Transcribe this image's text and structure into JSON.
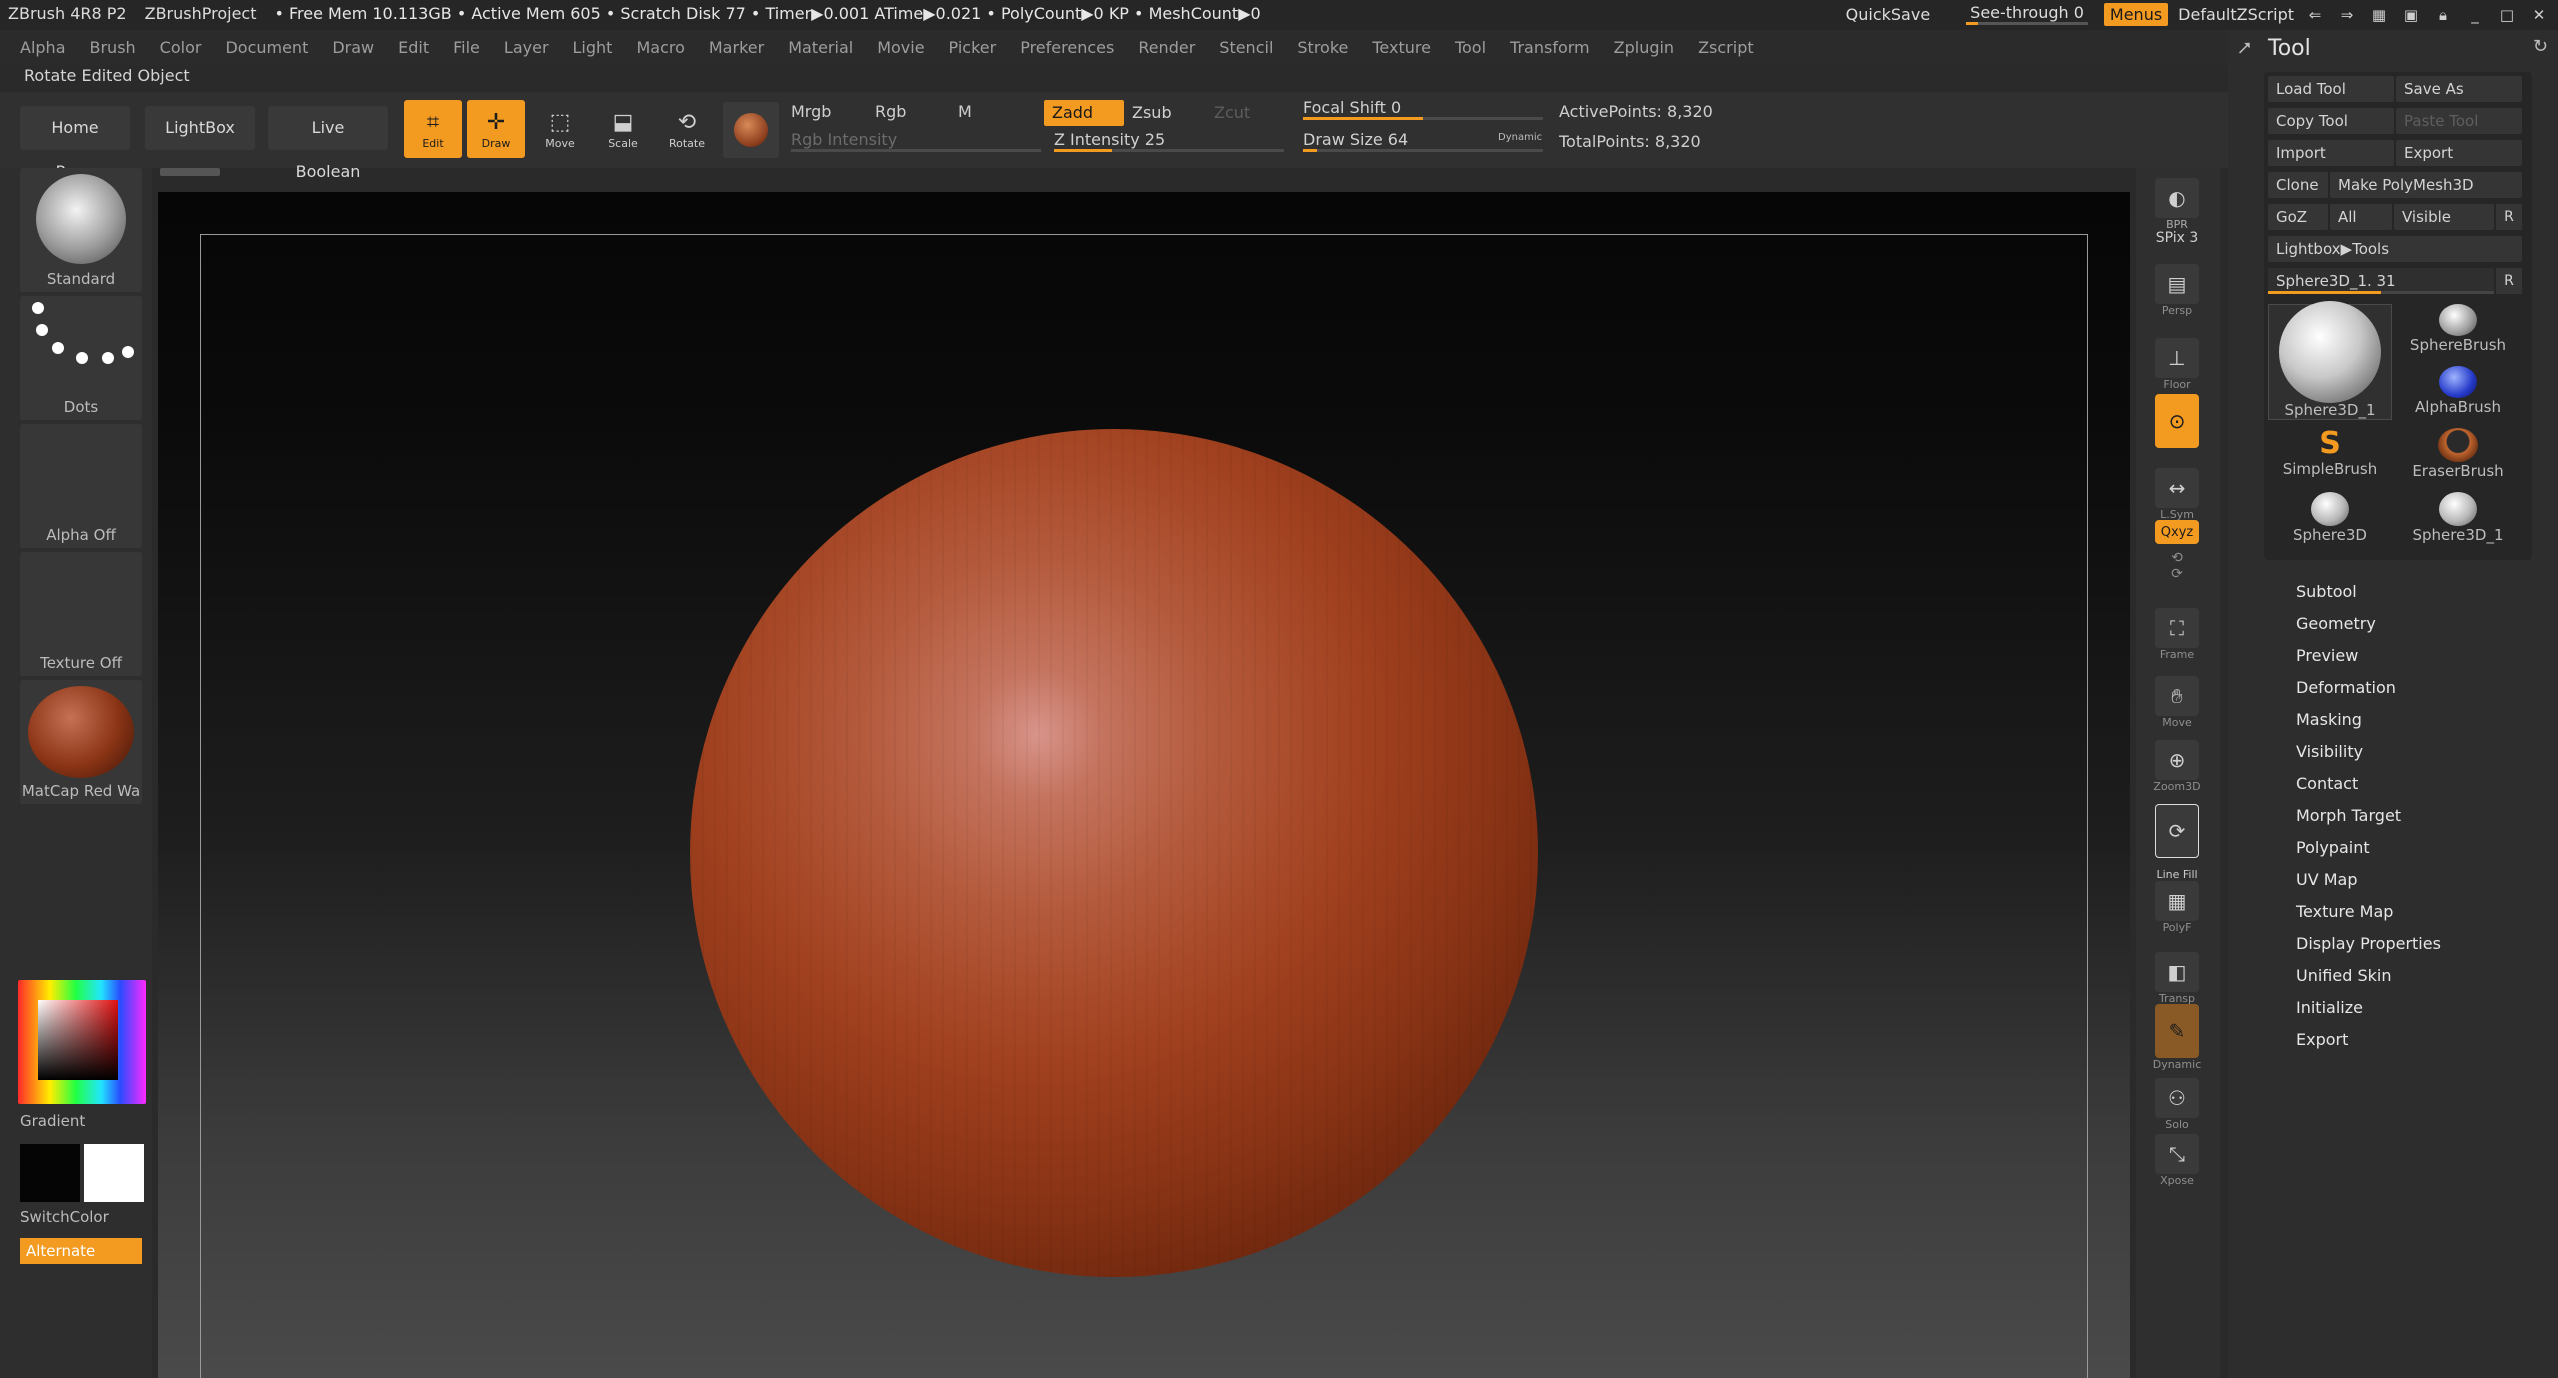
{
  "titlebar": {
    "app": "ZBrush 4R8 P2",
    "project": "ZBrushProject",
    "stats": "• Free Mem 10.113GB • Active Mem 605 • Scratch Disk 77 • Timer▶0.001 ATime▶0.021 • PolyCount▶0 KP • MeshCount▶0",
    "quicksave": "QuickSave",
    "seethrough": "See-through  0",
    "menus": "Menus",
    "script": "DefaultZScript"
  },
  "menubar": {
    "items": [
      "Alpha",
      "Brush",
      "Color",
      "Document",
      "Draw",
      "Edit",
      "File",
      "Layer",
      "Light",
      "Macro",
      "Marker",
      "Material",
      "Movie",
      "Picker",
      "Preferences",
      "Render",
      "Stencil",
      "Stroke",
      "Texture",
      "Tool",
      "Transform",
      "Zplugin",
      "Zscript"
    ]
  },
  "subtitle": "Rotate Edited Object",
  "shelf": {
    "home": "Home Page",
    "lightbox": "LightBox",
    "liveboolean": "Live Boolean",
    "edit": "Edit",
    "draw": "Draw",
    "move": "Move",
    "scale": "Scale",
    "rotate": "Rotate",
    "mrgb": "Mrgb",
    "rgb": "Rgb",
    "m": "M",
    "rgb_intensity": "Rgb Intensity",
    "zadd": "Zadd",
    "zsub": "Zsub",
    "zcut": "Zcut",
    "z_intensity": "Z Intensity 25",
    "z_intensity_value": 0.25,
    "focal_shift": "Focal Shift 0",
    "focal_shift_value": 0.5,
    "draw_size": "Draw Size 64",
    "draw_size_value": 0.06,
    "dynamic": "Dynamic",
    "active_points": "ActivePoints: 8,320",
    "total_points": "TotalPoints: 8,320"
  },
  "lefttray": {
    "brush": "Standard",
    "stroke": "Dots",
    "alpha": "Alpha Off",
    "texture": "Texture Off",
    "material": "MatCap Red Wa",
    "gradient": "Gradient",
    "switchcolor": "SwitchColor",
    "alternate": "Alternate"
  },
  "rshelf": {
    "bpr": "BPR",
    "spix": "SPix 3",
    "persp": "Persp",
    "dynamic": "Dynamic",
    "floor": "Floor",
    "local": "Local",
    "lsym": "L.Sym",
    "xyz": "Qxyz",
    "frame": "Frame",
    "move": "Move",
    "zoom3d": "Zoom3D",
    "rotate": "Rotate",
    "linefill": "Line Fill",
    "polyf": "PolyF",
    "transp": "Transp",
    "ghost": "Dynamic",
    "solo": "Solo",
    "xpose": "Xpose"
  },
  "tool_palette": {
    "title": "Tool",
    "load": "Load Tool",
    "saveas": "Save As",
    "copy": "Copy Tool",
    "paste": "Paste Tool",
    "import": "Import",
    "export": "Export",
    "clone": "Clone",
    "make_polymesh": "Make PolyMesh3D",
    "goz": "GoZ",
    "all": "All",
    "visible": "Visible",
    "r": "R",
    "lightbox_tools": "Lightbox▶Tools",
    "current_tool": "Sphere3D_1. 31",
    "current_tool_slider_value": 0.5,
    "thumbs": [
      "Sphere3D_1",
      "SphereBrush",
      "AlphaBrush",
      "SimpleBrush",
      "EraserBrush",
      "Sphere3D",
      "Sphere3D_1"
    ],
    "sections": [
      "Subtool",
      "Geometry",
      "Preview",
      "Deformation",
      "Masking",
      "Visibility",
      "Contact",
      "Morph Target",
      "Polypaint",
      "UV Map",
      "Texture Map",
      "Display Properties",
      "Unified Skin",
      "Initialize",
      "Export"
    ]
  },
  "colors": {
    "accent": "#f39a21",
    "material": "#a1411f"
  }
}
